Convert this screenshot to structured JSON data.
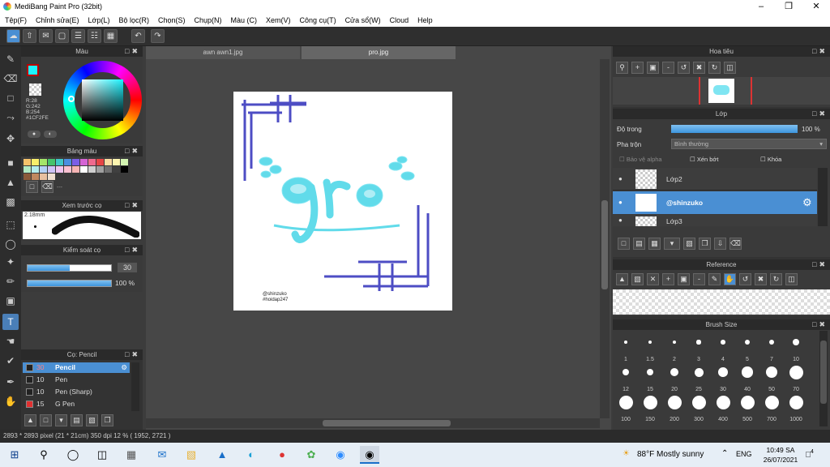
{
  "window": {
    "title": "MediBang Paint Pro (32bit)"
  },
  "menu": [
    "Tệp(F)",
    "Chỉnh sửa(E)",
    "Lớp(L)",
    "Bộ lọc(R)",
    "Chọn(S)",
    "Chụp(N)",
    "Màu (C)",
    "Xem(V)",
    "Công cụ(T)",
    "Cửa sổ(W)",
    "Cloud",
    "Help"
  ],
  "panels": {
    "color": {
      "title": "Màu",
      "r": "R:28",
      "g": "G:242",
      "b": "B:254",
      "hex": "#1CF2FE",
      "fg_color": "#1CF2FE"
    },
    "palette": {
      "title": "Bảng màu",
      "colors": [
        "#f5c26b",
        "#f9ee6a",
        "#a5e56a",
        "#46c36b",
        "#40c7c7",
        "#4a8fe0",
        "#7a5fe6",
        "#d464d4",
        "#ef6a8e",
        "#e64545",
        "#fadca2",
        "#fdf5b0",
        "#d3f3b1",
        "#b1e9c3",
        "#b4ecec",
        "#b3d1f5",
        "#cfc4f7",
        "#efc4ef",
        "#f9c1d1",
        "#f6b4b4",
        "#ffffff",
        "#d0d0d0",
        "#a0a0a0",
        "#707070",
        "#404040",
        "#000000",
        "#8a5a3a",
        "#c08860",
        "#e8c0a0",
        "#f0e0d0"
      ],
      "extra": "---"
    },
    "preview": {
      "title": "Xem trước cọ",
      "size_label": "2.18mm"
    },
    "control": {
      "title": "Kiểm soát cọ",
      "size": "30",
      "opacity": "100 %",
      "size_fraction": 0.5,
      "opacity_fraction": 1.0
    },
    "brush": {
      "title": "Cọ: Pencil",
      "items": [
        {
          "size": "30",
          "name": "Pencil",
          "color": "#222"
        },
        {
          "size": "10",
          "name": "Pen",
          "color": "#222"
        },
        {
          "size": "10",
          "name": "Pen (Sharp)",
          "color": "#222"
        },
        {
          "size": "15",
          "name": "G Pen",
          "color": "#e03030"
        }
      ]
    }
  },
  "tabs": [
    "awn awn1.jpg",
    "pro.jpg"
  ],
  "artwork": {
    "word": "gro",
    "credit_1": "@shinzuko",
    "credit_2": "#hoidap247"
  },
  "navigator": {
    "title": "Hoa tiêu"
  },
  "layers": {
    "title": "Lớp",
    "opacity_label": "Độ trong",
    "opacity_value": "100 %",
    "blend_label": "Pha trộn",
    "blend_value": "Bình thường",
    "protect_alpha": "Bảo vệ alpha",
    "clipping": "Xén bớt",
    "lock": "Khóa",
    "items": [
      {
        "name": "Lớp2"
      },
      {
        "name": "@shinzuko"
      },
      {
        "name": "Lớp3"
      }
    ]
  },
  "reference": {
    "title": "Reference"
  },
  "brush_size": {
    "title": "Brush Size",
    "sizes": [
      "1",
      "1.5",
      "2",
      "3",
      "4",
      "5",
      "7",
      "10",
      "12",
      "15",
      "20",
      "25",
      "30",
      "40",
      "50",
      "70",
      "100",
      "150",
      "200",
      "300",
      "400",
      "500",
      "700",
      "1000"
    ]
  },
  "status": {
    "text": "2893 * 2893 pixel  (21 * 21cm)  350 dpi  12 %  ( 1952, 2721 )"
  },
  "taskbar": {
    "weather": "88°F  Mostly sunny",
    "lang": "ENG",
    "time": "10:49 SA",
    "date": "26/07/2021",
    "notif": "4"
  }
}
